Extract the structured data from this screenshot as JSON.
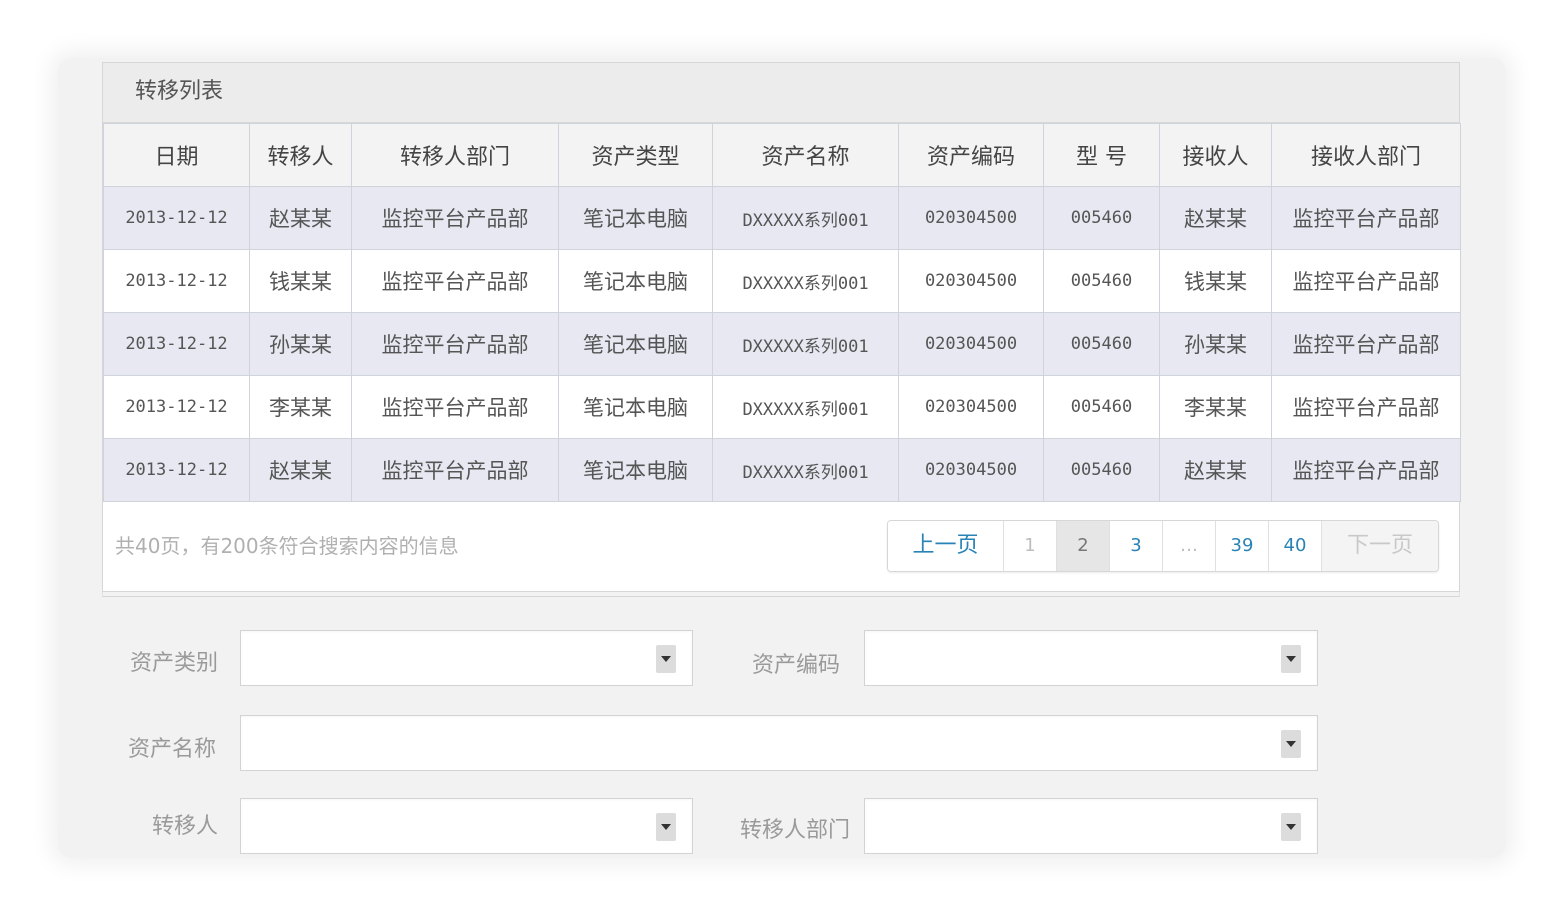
{
  "panel": {
    "title": "转移列表"
  },
  "table": {
    "columns": [
      "日期",
      "转移人",
      "转移人部门",
      "资产类型",
      "资产名称",
      "资产编码",
      "型 号",
      "接收人",
      "接收人部门"
    ],
    "rows": [
      [
        "2013-12-12",
        "赵某某",
        "监控平台产品部",
        "笔记本电脑",
        "DXXXXX系列001",
        "020304500",
        "005460",
        "赵某某",
        "监控平台产品部"
      ],
      [
        "2013-12-12",
        "钱某某",
        "监控平台产品部",
        "笔记本电脑",
        "DXXXXX系列001",
        "020304500",
        "005460",
        "钱某某",
        "监控平台产品部"
      ],
      [
        "2013-12-12",
        "孙某某",
        "监控平台产品部",
        "笔记本电脑",
        "DXXXXX系列001",
        "020304500",
        "005460",
        "孙某某",
        "监控平台产品部"
      ],
      [
        "2013-12-12",
        "李某某",
        "监控平台产品部",
        "笔记本电脑",
        "DXXXXX系列001",
        "020304500",
        "005460",
        "李某某",
        "监控平台产品部"
      ],
      [
        "2013-12-12",
        "赵某某",
        "监控平台产品部",
        "笔记本电脑",
        "DXXXXX系列001",
        "020304500",
        "005460",
        "赵某某",
        "监控平台产品部"
      ]
    ]
  },
  "footer": {
    "summary": "共40页，有200条符合搜索内容的信息"
  },
  "pager": {
    "prev": "上一页",
    "pages": [
      "1",
      "2",
      "3",
      "…",
      "39",
      "40"
    ],
    "current": "2",
    "next": "下一页"
  },
  "form": {
    "asset_category_label": "资产类别",
    "asset_code_label": "资产编码",
    "asset_name_label": "资产名称",
    "transferor_label": "转移人",
    "transferor_dept_label": "转移人部门"
  },
  "colors": {
    "accent": "#2a83b6",
    "row_alt": "#e8e8f2"
  }
}
